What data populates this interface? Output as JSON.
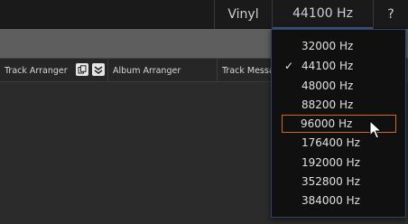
{
  "topbar": {
    "vinyl_label": "Vinyl",
    "sample_rate_label": "44100 Hz",
    "help_label": "?"
  },
  "tabs": [
    {
      "label": "Track Arranger"
    },
    {
      "label": "Album Arranger"
    },
    {
      "label": "Track Messa"
    }
  ],
  "icons": {
    "copy": "copy-icon",
    "collapse": "collapse-icon",
    "check": "checkmark-icon",
    "cursor": "mouse-pointer-icon"
  },
  "sample_rate_menu": {
    "options": [
      {
        "label": "32000 Hz"
      },
      {
        "label": "44100 Hz",
        "checked": true
      },
      {
        "label": "48000 Hz"
      },
      {
        "label": "88200 Hz"
      },
      {
        "label": "96000 Hz",
        "hovered": true
      },
      {
        "label": "176400 Hz"
      },
      {
        "label": "192000 Hz"
      },
      {
        "label": "352800 Hz"
      },
      {
        "label": "384000 Hz"
      }
    ],
    "check_glyph": "✓"
  },
  "colors": {
    "menu_border": "#2f4766",
    "hover_outline": "#d2691e"
  }
}
